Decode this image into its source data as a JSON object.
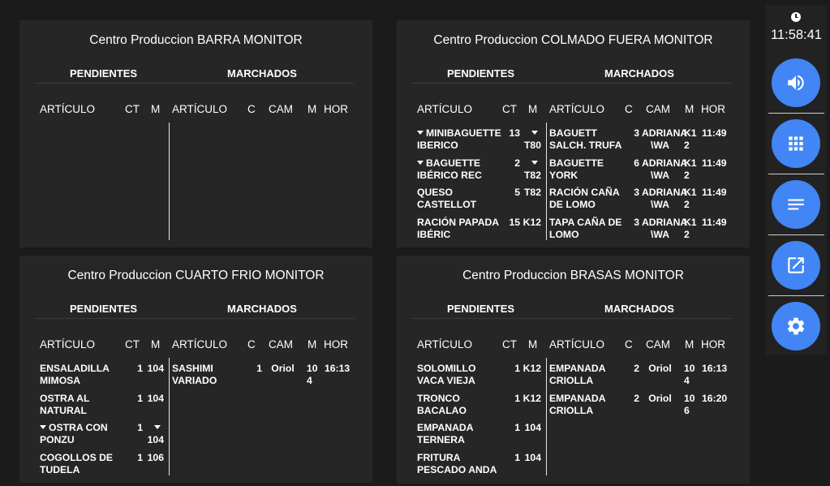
{
  "clock": "11:58:41",
  "columns": {
    "pendientes": "PENDIENTES",
    "marchados": "MARCHADOS",
    "articulo": "ARTÍCULO",
    "ct": "CT",
    "m": "M",
    "c": "C",
    "cam": "CAM",
    "hor": "HOR"
  },
  "panels": [
    {
      "title": "Centro Produccion BARRA MONITOR",
      "pending": [],
      "marched": []
    },
    {
      "title": "Centro Produccion COLMADO FUERA MONITOR",
      "pending": [
        {
          "articulo": "MINIBAGUETTE IBERICO",
          "ct": "13",
          "m": "T80",
          "caret": true
        },
        {
          "articulo": "BAGUETTE IBÉRICO REC",
          "ct": "2",
          "m": "T82",
          "caret": true
        },
        {
          "articulo": "QUESO CASTELLOT",
          "ct": "5",
          "m": "T82",
          "caret": false
        },
        {
          "articulo": "RACIÓN PAPADA IBÉRIC",
          "ct": "15",
          "m": "K12",
          "caret": false
        }
      ],
      "marched": [
        {
          "articulo": "BAGUETT SALCH. TRUFA",
          "c": "3",
          "cam": "ADRIANA \\WA",
          "m": "K1 2",
          "hor": "11:49"
        },
        {
          "articulo": "BAGUETTE YORK",
          "c": "6",
          "cam": "ADRIANA \\WA",
          "m": "K1 2",
          "hor": "11:49"
        },
        {
          "articulo": "RACIÓN CAÑA DE LOMO",
          "c": "3",
          "cam": "ADRIANA \\WA",
          "m": "K1 2",
          "hor": "11:49"
        },
        {
          "articulo": "TAPA CAÑA DE LOMO",
          "c": "3",
          "cam": "ADRIANA \\WA",
          "m": "K1 2",
          "hor": "11:49"
        }
      ]
    },
    {
      "title": "Centro Produccion CUARTO FRIO MONITOR",
      "pending": [
        {
          "articulo": "ENSALADILLA MIMOSA",
          "ct": "1",
          "m": "104",
          "caret": false
        },
        {
          "articulo": "OSTRA AL NATURAL",
          "ct": "1",
          "m": "104",
          "caret": false
        },
        {
          "articulo": "OSTRA CON PONZU",
          "ct": "1",
          "m": "104",
          "caret": true
        },
        {
          "articulo": "COGOLLOS DE TUDELA",
          "ct": "1",
          "m": "106",
          "caret": false
        }
      ],
      "marched": [
        {
          "articulo": "SASHIMI VARIADO",
          "c": "1",
          "cam": "Oriol",
          "m": "10 4",
          "hor": "16:13"
        }
      ]
    },
    {
      "title": "Centro Produccion BRASAS MONITOR",
      "pending": [
        {
          "articulo": "SOLOMILLO VACA VIEJA",
          "ct": "1",
          "m": "K12",
          "caret": false
        },
        {
          "articulo": "TRONCO BACALAO",
          "ct": "1",
          "m": "K12",
          "caret": false
        },
        {
          "articulo": "EMPANADA TERNERA",
          "ct": "1",
          "m": "104",
          "caret": false
        },
        {
          "articulo": "FRITURA PESCADO ANDA",
          "ct": "1",
          "m": "104",
          "caret": false
        }
      ],
      "marched": [
        {
          "articulo": "EMPANADA CRIOLLA",
          "c": "2",
          "cam": "Oriol",
          "m": "10 4",
          "hor": "16:13"
        },
        {
          "articulo": "EMPANADA CRIOLLA",
          "c": "2",
          "cam": "Oriol",
          "m": "10 6",
          "hor": "16:20"
        }
      ]
    }
  ],
  "sidebar": [
    {
      "icon": "volume-icon",
      "color": "#4285f4"
    },
    {
      "icon": "grid-icon",
      "color": "#4285f4"
    },
    {
      "icon": "notes-icon",
      "color": "#4285f4"
    },
    {
      "icon": "open-in-new-icon",
      "color": "#4285f4"
    },
    {
      "icon": "settings-icon",
      "color": "#4285f4"
    }
  ]
}
